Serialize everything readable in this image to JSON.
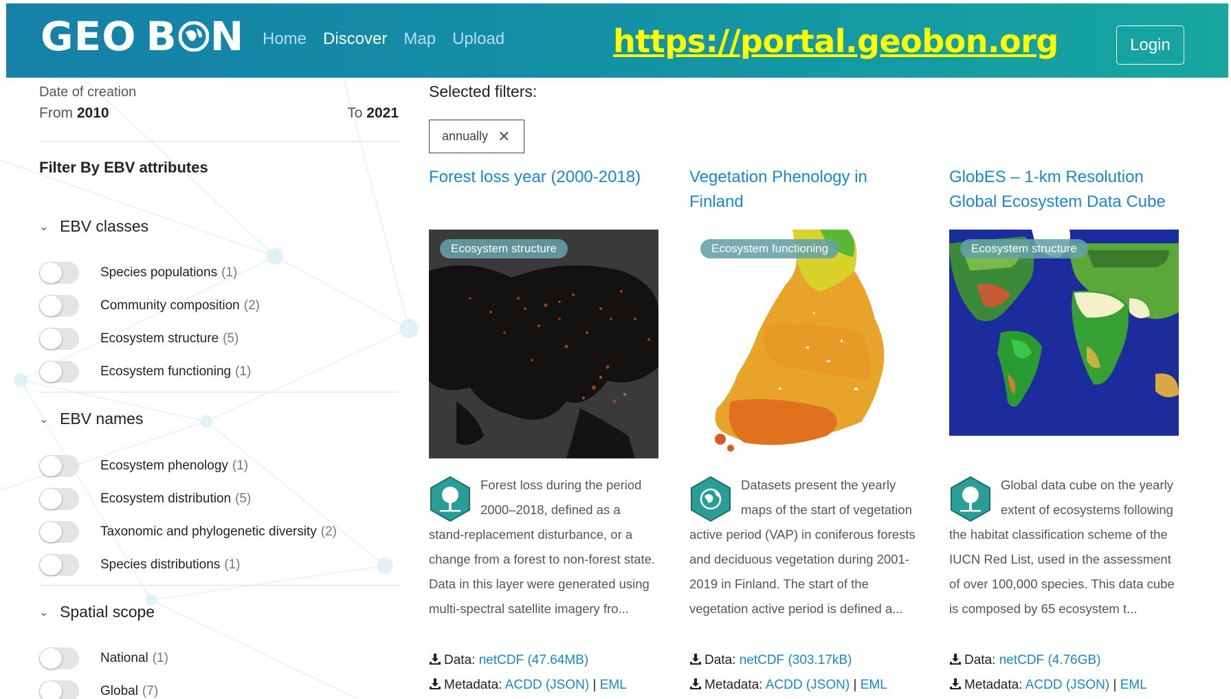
{
  "header": {
    "logo_text_left": "GEO",
    "logo_text_right": "B",
    "logo_text_end": "N",
    "nav": [
      {
        "label": "Home",
        "active": false
      },
      {
        "label": "Discover",
        "active": true
      },
      {
        "label": "Map",
        "active": false
      },
      {
        "label": "Upload",
        "active": false
      }
    ],
    "url_overlay": "https://portal.geobon.org",
    "login_label": "Login"
  },
  "sidebar": {
    "date_label": "Date of creation",
    "from_label": "From",
    "from_value": "2010",
    "to_label": "To",
    "to_value": "2021",
    "filter_title": "Filter By EBV attributes",
    "sections": [
      {
        "title": "EBV classes",
        "items": [
          {
            "label": "Species populations",
            "count": "(1)"
          },
          {
            "label": "Community composition",
            "count": "(2)"
          },
          {
            "label": "Ecosystem structure",
            "count": "(5)"
          },
          {
            "label": "Ecosystem functioning",
            "count": "(1)"
          }
        ]
      },
      {
        "title": "EBV names",
        "items": [
          {
            "label": "Ecosystem phenology",
            "count": "(1)"
          },
          {
            "label": "Ecosystem distribution",
            "count": "(5)"
          },
          {
            "label": "Taxonomic and phylogenetic diversity",
            "count": "(2)"
          },
          {
            "label": "Species distributions",
            "count": "(1)"
          }
        ]
      },
      {
        "title": "Spatial scope",
        "items": [
          {
            "label": "National",
            "count": "(1)"
          },
          {
            "label": "Global",
            "count": "(7)"
          }
        ]
      }
    ]
  },
  "main": {
    "selected_filters_label": "Selected filters:",
    "filter_chip": "annually",
    "cards": [
      {
        "title": "Forest loss year (2000-2018)",
        "badge": "Ecosystem structure",
        "icon": "tree-hex-icon",
        "description": "Forest loss during the period 2000–2018, defined as a stand-replacement disturbance, or a change from a forest to non-forest state. Data in this layer were generated using multi-spectral satellite imagery fro...",
        "data_label": "Data:",
        "data_link": "netCDF (47.64MB)",
        "metadata_label": "Metadata:",
        "metadata_link": "ACDD (JSON)",
        "separator": "|",
        "eml_link": "EML"
      },
      {
        "title": "Vegetation Phenology in Finland",
        "badge": "Ecosystem functioning",
        "icon": "globe-leaf-hex-icon",
        "description": "Datasets present the yearly maps of the start of vegetation active period (VAP) in coniferous forests and deciduous vegetation during 2001-2019 in Finland. The start of the vegetation active period is defined a...",
        "data_label": "Data:",
        "data_link": "netCDF (303.17kB)",
        "metadata_label": "Metadata:",
        "metadata_link": "ACDD (JSON)",
        "separator": "|",
        "eml_link": "EML"
      },
      {
        "title": "GlobES – 1-km Resolution Global Ecosystem Data Cube",
        "badge": "Ecosystem structure",
        "icon": "tree-hex-icon",
        "description": "Global data cube on the yearly extent of ecosystems following the habitat classification scheme of the IUCN Red List, used in the assessment of over 100,000 species. This data cube is composed by 65 ecosystem t...",
        "data_label": "Data:",
        "data_link": "netCDF (4.76GB)",
        "metadata_label": "Metadata:",
        "metadata_link": "ACDD (JSON)",
        "separator": "|",
        "eml_link": "EML"
      }
    ]
  },
  "colors": {
    "header_start": "#1580a8",
    "header_end": "#17a6a0",
    "link": "#1a86d3",
    "url_overlay": "#ffff00",
    "badge_bg": "#64a0a5",
    "hex_icon": "#2a9d96"
  }
}
